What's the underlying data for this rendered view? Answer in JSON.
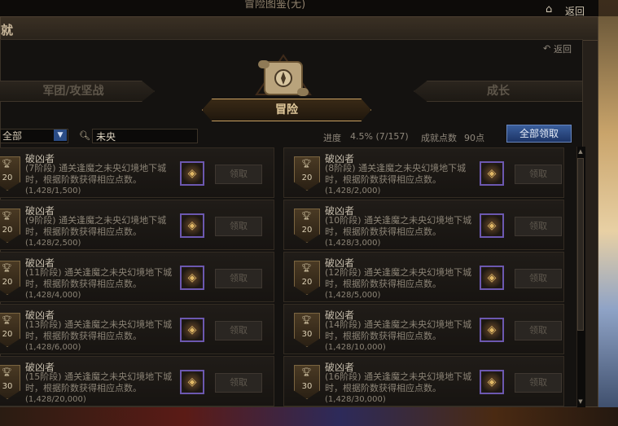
{
  "window": {
    "title": "冒险图鉴(无)",
    "outer_title": "就",
    "return_label": "返回",
    "back_label": "返回"
  },
  "tabs": {
    "left": "军团/攻坚战",
    "center": "冒险",
    "right": "成长"
  },
  "filter": {
    "selected": "全部",
    "search_value": "未央"
  },
  "stats": {
    "progress_label": "进度",
    "progress_value": "4.5% (7/157)",
    "points_label": "成就点数",
    "points_value": "90点",
    "claim_all_label": "全部领取"
  },
  "colors": {
    "accent_gold": "#c9a062",
    "claim_all_blue": "#2a4c86",
    "reward_border": "#6c58b0"
  },
  "achievements": [
    {
      "points": "20",
      "name": "破凶者",
      "desc": "(7阶段) 通关逢魔之未央幻境地下城时，根据阶数获得相应点数。",
      "progress": "(1,428/1,500)",
      "claim": "领取"
    },
    {
      "points": "20",
      "name": "破凶者",
      "desc": "(8阶段) 通关逢魔之未央幻境地下城时，根据阶数获得相应点数。",
      "progress": "(1,428/2,000)",
      "claim": "领取"
    },
    {
      "points": "20",
      "name": "破凶者",
      "desc": "(9阶段) 通关逢魔之未央幻境地下城时，根据阶数获得相应点数。",
      "progress": "(1,428/2,500)",
      "claim": "领取"
    },
    {
      "points": "20",
      "name": "破凶者",
      "desc": "(10阶段) 通关逢魔之未央幻境地下城时，根据阶数获得相应点数。",
      "progress": "(1,428/3,000)",
      "claim": "领取"
    },
    {
      "points": "20",
      "name": "破凶者",
      "desc": "(11阶段) 通关逢魔之未央幻境地下城时，根据阶数获得相应点数。",
      "progress": "(1,428/4,000)",
      "claim": "领取"
    },
    {
      "points": "20",
      "name": "破凶者",
      "desc": "(12阶段) 通关逢魔之未央幻境地下城时，根据阶数获得相应点数。",
      "progress": "(1,428/5,000)",
      "claim": "领取"
    },
    {
      "points": "20",
      "name": "破凶者",
      "desc": "(13阶段) 通关逢魔之未央幻境地下城时，根据阶数获得相应点数。",
      "progress": "(1,428/6,000)",
      "claim": "领取"
    },
    {
      "points": "30",
      "name": "破凶者",
      "desc": "(14阶段) 通关逢魔之未央幻境地下城时，根据阶数获得相应点数。",
      "progress": "(1,428/10,000)",
      "claim": "领取"
    },
    {
      "points": "30",
      "name": "破凶者",
      "desc": "(15阶段) 通关逢魔之未央幻境地下城时，根据阶数获得相应点数。",
      "progress": "(1,428/20,000)",
      "claim": "领取"
    },
    {
      "points": "30",
      "name": "破凶者",
      "desc": "(16阶段) 通关逢魔之未央幻境地下城时，根据阶数获得相应点数。",
      "progress": "(1,428/30,000)",
      "claim": "领取"
    }
  ]
}
